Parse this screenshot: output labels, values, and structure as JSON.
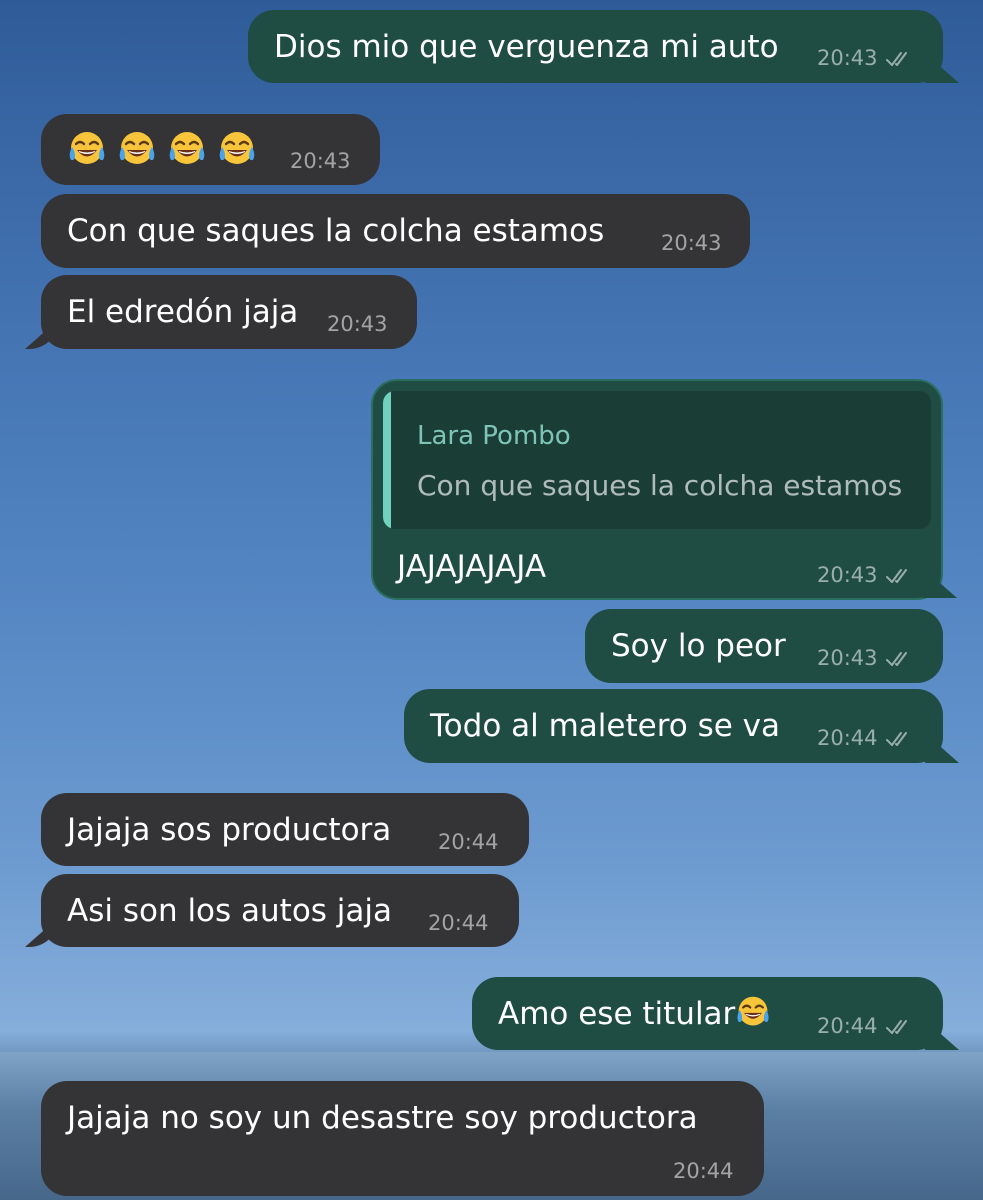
{
  "messages": [
    {
      "id": "m1",
      "dir": "out",
      "text": "Dios mio que verguenza mi auto",
      "time": "20:43"
    },
    {
      "id": "m2",
      "dir": "in",
      "emoji": [
        "face-with-tears-of-joy",
        "face-with-tears-of-joy",
        "face-with-tears-of-joy",
        "face-with-tears-of-joy"
      ],
      "time": "20:43"
    },
    {
      "id": "m3",
      "dir": "in",
      "text": "Con que saques la colcha estamos",
      "time": "20:43"
    },
    {
      "id": "m4",
      "dir": "in",
      "text": "El edredón jaja",
      "time": "20:43"
    },
    {
      "id": "m5",
      "dir": "out",
      "reply": {
        "name": "Lara Pombo",
        "text": "Con que saques la colcha estamos"
      },
      "text": "JAJAJAJAJA",
      "time": "20:43"
    },
    {
      "id": "m6",
      "dir": "out",
      "text": "Soy lo peor",
      "time": "20:43"
    },
    {
      "id": "m7",
      "dir": "out",
      "text": "Todo al maletero se va",
      "time": "20:44"
    },
    {
      "id": "m8",
      "dir": "in",
      "text": "Jajaja sos productora",
      "time": "20:44"
    },
    {
      "id": "m9",
      "dir": "in",
      "text": "Asi son los autos jaja",
      "time": "20:44"
    },
    {
      "id": "m10",
      "dir": "out",
      "text": "Amo ese titular",
      "emoji_suffix": "face-with-tears-of-joy",
      "time": "20:44"
    },
    {
      "id": "m11",
      "dir": "in",
      "text": "Jajaja no soy un desastre soy productora",
      "time": "20:44"
    }
  ],
  "colors": {
    "incoming_bubble": "#343437",
    "outgoing_bubble": "#1f4d44",
    "quote_bar": "#6fd1be",
    "quote_name": "#7ec4b6"
  }
}
